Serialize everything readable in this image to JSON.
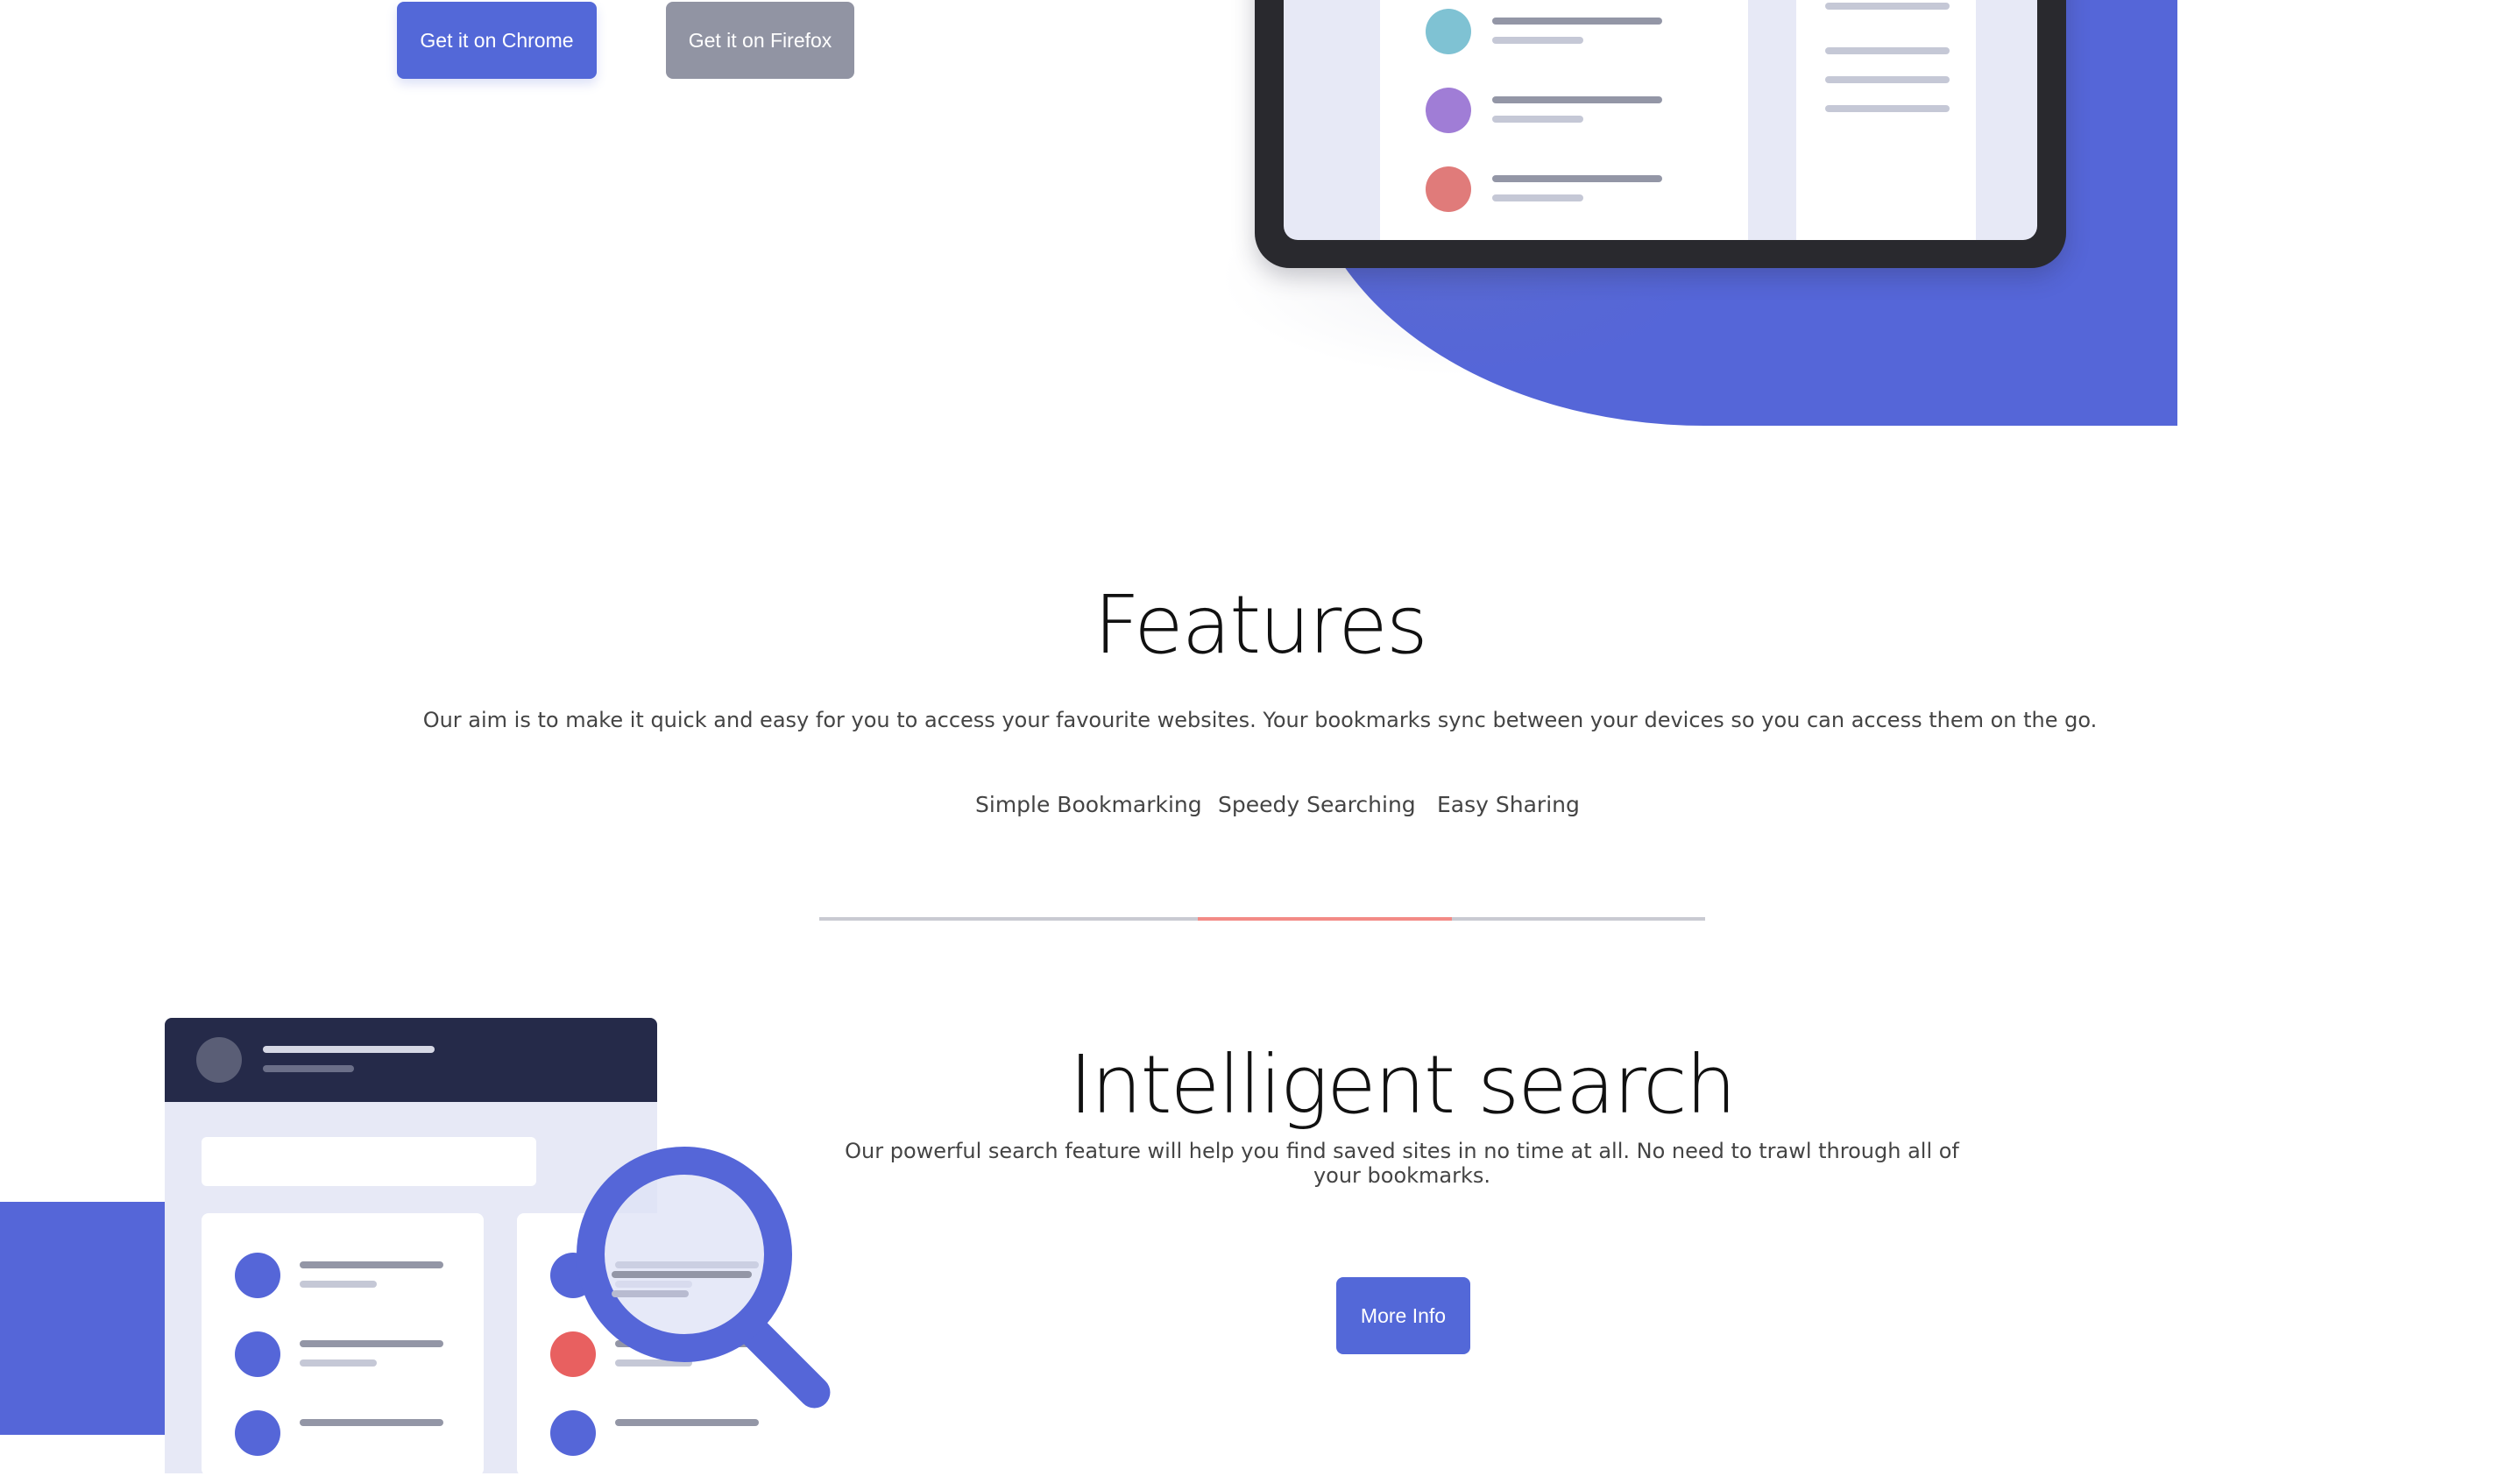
{
  "hero": {
    "chrome_button": "Get it on Chrome",
    "firefox_button": "Get it on Firefox"
  },
  "features": {
    "title": "Features",
    "description": "Our aim is to make it quick and easy for you to access your favourite websites. Your bookmarks sync between your devices so you can access them on the go.",
    "tabs": [
      {
        "label": "Simple Bookmarking"
      },
      {
        "label": "Speedy Searching",
        "active": true
      },
      {
        "label": "Easy Sharing"
      }
    ]
  },
  "intelligent_search": {
    "title": "Intelligent search",
    "description": "Our powerful search feature will help you find saved sites in no time at all. No need to trawl through all of your bookmarks.",
    "more_info_button": "More Info"
  },
  "colors": {
    "brand_blue": "#5368d8",
    "secondary_gray": "#9194a3",
    "active_tab_underline": "#f38b86",
    "dark_navy": "#252a49",
    "dot_teal": "#7fc2d3",
    "dot_purple": "#a07dd6",
    "dot_red": "#e07b7a",
    "dot_alert_red": "#e86060"
  },
  "icons": {
    "hero_illustration": "tablet-bookmarks-illustration",
    "search_illustration": "magnifier-illustration"
  }
}
